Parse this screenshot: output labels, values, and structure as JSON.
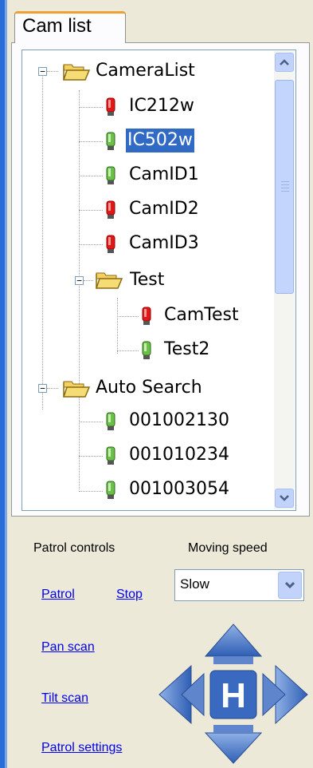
{
  "tab": {
    "label": "Cam list"
  },
  "tree": {
    "root": {
      "label": "CameraList"
    },
    "items": [
      {
        "label": "IC212w",
        "status": "offline"
      },
      {
        "label": "IC502w",
        "status": "online",
        "selected": true
      },
      {
        "label": "CamID1",
        "status": "online"
      },
      {
        "label": "CamID2",
        "status": "offline"
      },
      {
        "label": "CamID3",
        "status": "offline"
      }
    ],
    "subfolder": {
      "label": "Test",
      "items": [
        {
          "label": "CamTest",
          "status": "offline"
        },
        {
          "label": "Test2",
          "status": "online"
        }
      ]
    },
    "root2": {
      "label": "Auto Search",
      "items": [
        {
          "label": "001002130",
          "status": "online"
        },
        {
          "label": "001010234",
          "status": "online"
        },
        {
          "label": "001003054",
          "status": "online"
        }
      ]
    }
  },
  "controls": {
    "patrol_heading": "Patrol controls",
    "speed_heading": "Moving speed",
    "patrol_link": "Patrol",
    "stop_link": "Stop",
    "speed_value": "Slow",
    "pan_scan_link": "Pan scan",
    "tilt_scan_link": "Tilt scan",
    "patrol_settings_link": "Patrol settings",
    "home_label": "H"
  },
  "icons": {
    "folder": "folder-open-icon",
    "camera_online": "camera-online-icon",
    "camera_offline": "camera-offline-icon",
    "scroll_up": "chevron-up-icon",
    "scroll_down": "chevron-down-icon",
    "dropdown": "chevron-down-icon"
  },
  "colors": {
    "online": "#6cc04a",
    "offline": "#e01818",
    "selection": "#316ac5",
    "link": "#0000ee",
    "ptz_arrow": "#4a7ac8"
  }
}
